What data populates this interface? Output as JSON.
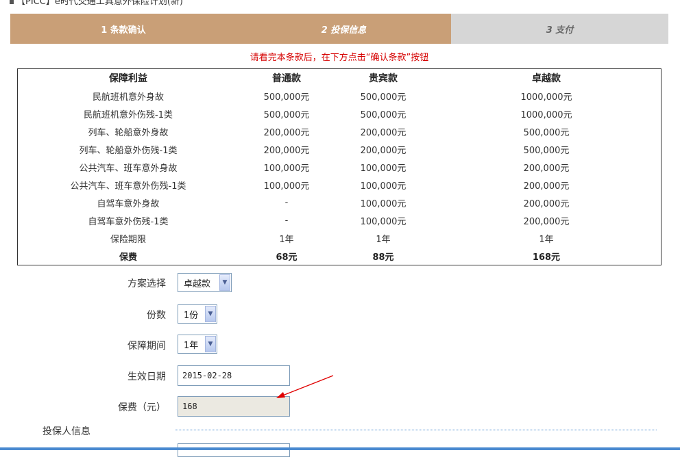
{
  "page_title": "【PICC】e时代交通工具意外保险计划(新)",
  "steps": [
    {
      "label": "1 条款确认"
    },
    {
      "label": "2 投保信息"
    },
    {
      "label": "3 支付"
    }
  ],
  "notice": "请看完本条款后，在下方点击“确认条款”按钮",
  "benefits": {
    "headers": [
      "保障利益",
      "普通款",
      "贵宾款",
      "卓越款"
    ],
    "rows": [
      [
        "民航班机意外身故",
        "500,000元",
        "500,000元",
        "1000,000元"
      ],
      [
        "民航班机意外伤残-1类",
        "500,000元",
        "500,000元",
        "1000,000元"
      ],
      [
        "列车、轮船意外身故",
        "200,000元",
        "200,000元",
        "500,000元"
      ],
      [
        "列车、轮船意外伤残-1类",
        "200,000元",
        "200,000元",
        "500,000元"
      ],
      [
        "公共汽车、班车意外身故",
        "100,000元",
        "100,000元",
        "200,000元"
      ],
      [
        "公共汽车、班车意外伤残-1类",
        "100,000元",
        "100,000元",
        "200,000元"
      ],
      [
        "自驾车意外身故",
        "-",
        "100,000元",
        "200,000元"
      ],
      [
        "自驾车意外伤残-1类",
        "-",
        "100,000元",
        "200,000元"
      ],
      [
        "保险期限",
        "1年",
        "1年",
        "1年"
      ]
    ],
    "fee_row": [
      "保费",
      "68元",
      "88元",
      "168元"
    ]
  },
  "form": {
    "plan": {
      "label": "方案选择",
      "value": "卓越款"
    },
    "copies": {
      "label": "份数",
      "value": "1份"
    },
    "period": {
      "label": "保障期间",
      "value": "1年"
    },
    "start_date": {
      "label": "生效日期",
      "value": "2015-02-28"
    },
    "premium": {
      "label": "保费（元）",
      "value": "168"
    }
  },
  "section_title": "投保人信息",
  "colors": {
    "step_active": "#c99f77",
    "step_inactive": "#d6d6d6",
    "notice": "#d60000",
    "arrow": "#e00000"
  },
  "icons": [
    "dropdown-arrow-icon",
    "annotation-arrow-icon"
  ]
}
